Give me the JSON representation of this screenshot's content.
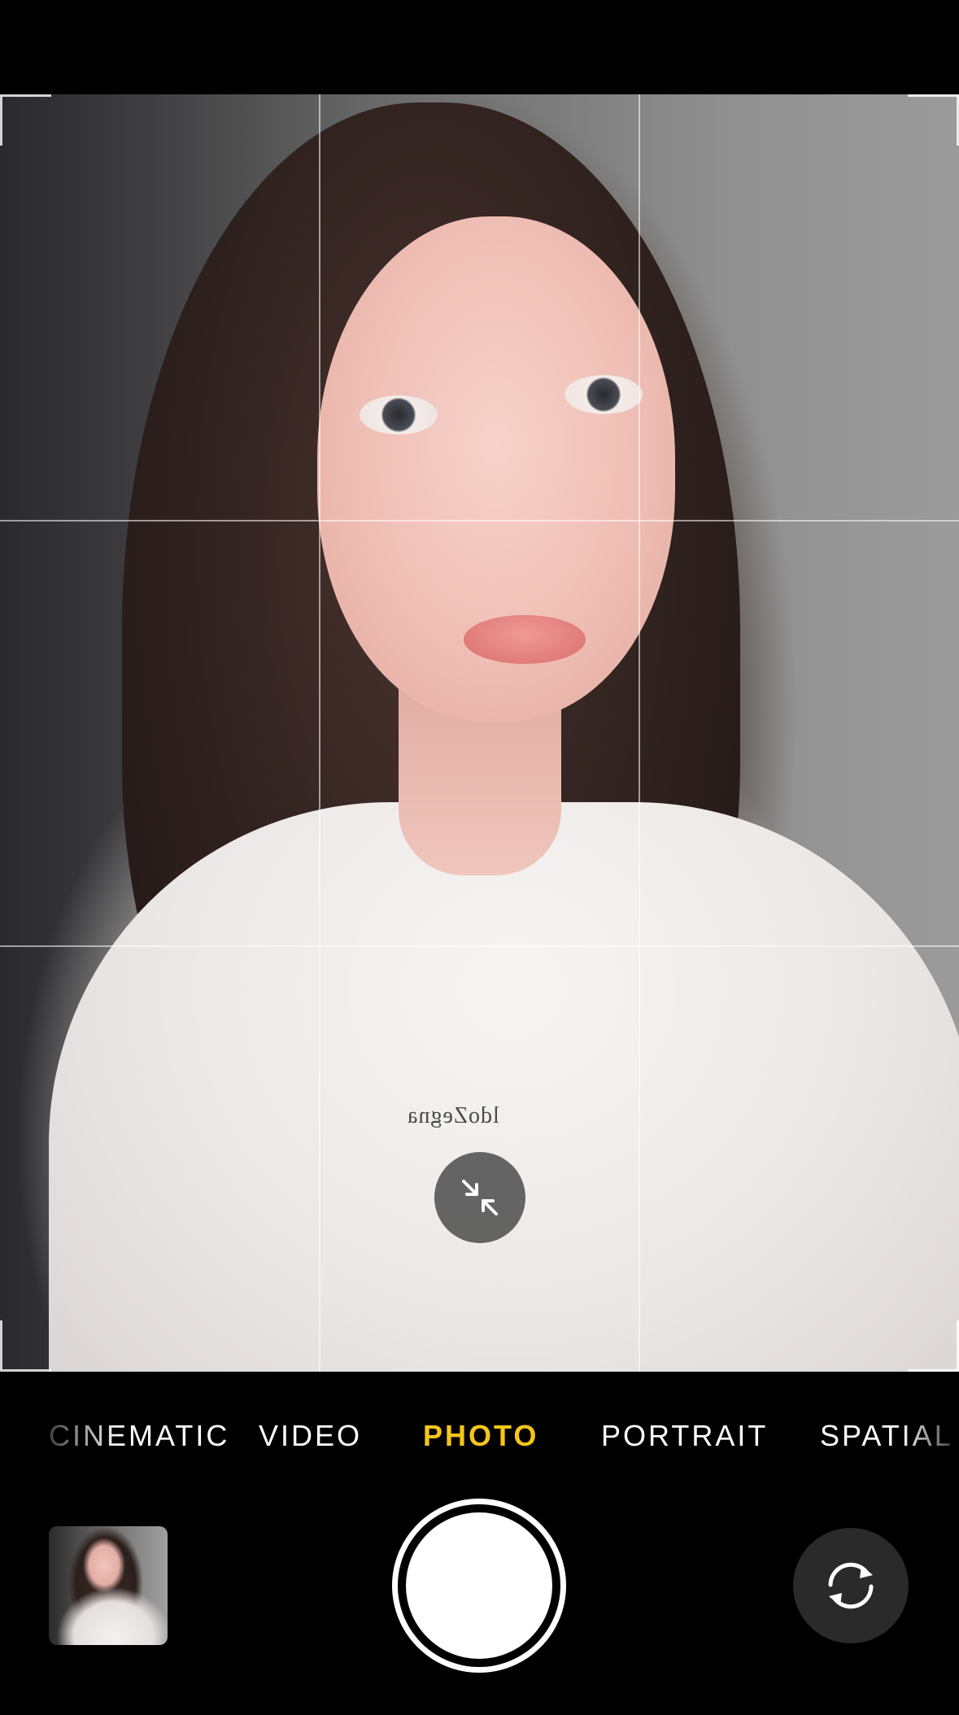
{
  "camera": {
    "modes": [
      {
        "label": "CINEMATIC",
        "active": false
      },
      {
        "label": "VIDEO",
        "active": false
      },
      {
        "label": "PHOTO",
        "active": true
      },
      {
        "label": "PORTRAIT",
        "active": false
      },
      {
        "label": "SPATIAL",
        "active": false
      }
    ],
    "shirt_print": "ldoZegna",
    "icons": {
      "zoom_toggle": "collapse-arrows-icon",
      "flip_camera": "rotate-arrows-icon"
    },
    "colors": {
      "active_mode": "#f5c51a",
      "background": "#000000"
    }
  }
}
